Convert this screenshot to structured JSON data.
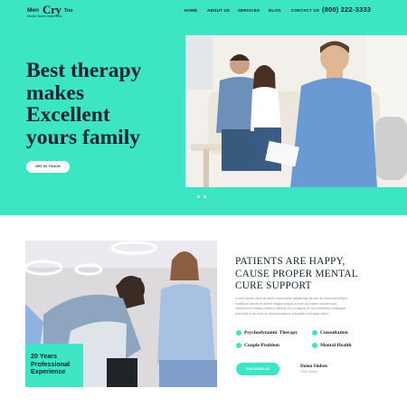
{
  "logo": {
    "part1": "Men",
    "part2": "Cry",
    "part3": "Too",
    "tagline": "Mental Health Awareness"
  },
  "nav": {
    "items": [
      {
        "label": "HOME"
      },
      {
        "label": "ABOUT US"
      },
      {
        "label": "SERVICES"
      },
      {
        "label": "BLOG"
      },
      {
        "label": "CONTACT US"
      }
    ],
    "phone": "(800) 222-3333"
  },
  "hero": {
    "headline_lines": [
      "Best therapy",
      "makes",
      "Excellent",
      "yours family"
    ],
    "cta_label": "GET IN TOUCH"
  },
  "about": {
    "badge_lines": [
      "20 Years",
      "Professional",
      "Experience"
    ],
    "title_lines": [
      "PATIENTS ARE HAPPY,",
      "CAUSE PROPER MENTAL",
      "CURE SUPPORT"
    ],
    "body_lines": [
      "Lorem ipsum dolor sit amet consectetur adipiscing elit sed do eiusmod tempor",
      "incididunt labore et dolore magna aliqua ut enim ad minim veniam quis",
      "nostrud exercitation ullamco laboris nisi ut aliquip ex ea commodo consequat",
      "duis aute irure dolor in reprehenderit in voluptate velit esse cillum."
    ],
    "features": [
      {
        "label": "Psychodynamic Therapy"
      },
      {
        "label": "Consultation"
      },
      {
        "label": "Couple Problem"
      },
      {
        "label": "Mental Health"
      }
    ],
    "button_label": "DISCOVER US",
    "signature": {
      "name": "Dolon Sinhen",
      "role": "CEO, Doctor"
    }
  },
  "colors": {
    "accent": "#3ce6c4",
    "dark": "#0f2330",
    "muted": "#8a8f95"
  }
}
